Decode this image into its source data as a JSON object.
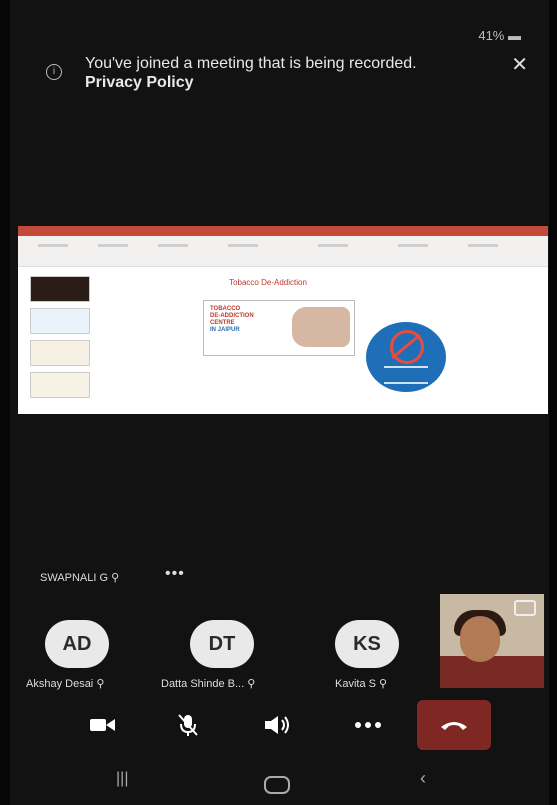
{
  "status_bar": {
    "battery": "41%"
  },
  "banner": {
    "message": "You've joined a meeting that is being recorded.",
    "link": "Privacy Policy"
  },
  "shared_content": {
    "slide_title": "Tobacco De-Addiction",
    "image_text_line1": "TOBACCO",
    "image_text_line2": "DE-ADDICTION",
    "image_text_line3": "CENTRE",
    "image_text_line4": "IN JAIPUR",
    "accent_color": "#c24a3a"
  },
  "presenter": {
    "name": "SWAPNALI G"
  },
  "participants": [
    {
      "initials": "AD",
      "name": "Akshay Desai"
    },
    {
      "initials": "DT",
      "name": "Datta Shinde B..."
    },
    {
      "initials": "KS",
      "name": "Kavita S"
    }
  ],
  "controls": {
    "icons": [
      "video-camera-icon",
      "mic-off-icon",
      "speaker-icon",
      "more-icon",
      "end-call-icon"
    ],
    "end_call_color": "#7f2723"
  },
  "nav": {
    "icons": [
      "recent-apps-icon",
      "home-icon",
      "back-icon"
    ]
  }
}
